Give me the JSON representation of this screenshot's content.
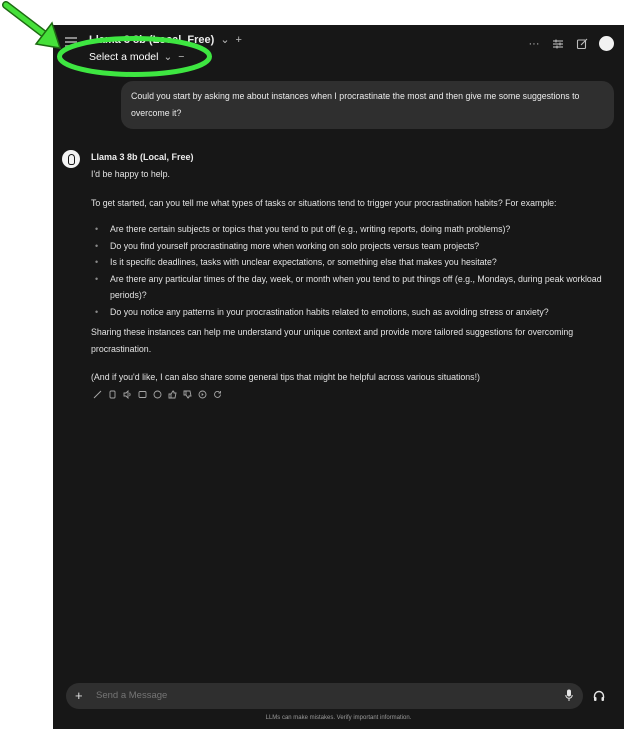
{
  "header": {
    "model_title": "Llama 3 8b (Local, Free)",
    "model_chevron": "⌄",
    "add_model": "+",
    "select_model": "Select a model",
    "select_chevron": "⌄",
    "remove_model": "−",
    "more_label": "···",
    "icons": [
      "menu-icon",
      "more-icon",
      "sliders-icon",
      "edit-icon",
      "avatar"
    ]
  },
  "user_message": "Could you start by asking me about instances when I procrastinate the most and then give me some suggestions to overcome it?",
  "assistant": {
    "name": "Llama 3 8b (Local, Free)",
    "intro": "I'd be happy to help.",
    "lead": "To get started, can you tell me what types of tasks or situations tend to trigger your procrastination habits? For example:",
    "bullets": [
      "Are there certain subjects or topics that you tend to put off (e.g., writing reports, doing math problems)?",
      "Do you find yourself procrastinating more when working on solo projects versus team projects?",
      "Is it specific deadlines, tasks with unclear expectations, or something else that makes you hesitate?",
      "Are there any particular times of the day, week, or month when you tend to put things off (e.g., Mondays, during peak workload periods)?",
      "Do you notice any patterns in your procrastination habits related to emotions, such as avoiding stress or anxiety?"
    ],
    "closing": "Sharing these instances can help me understand your unique context and provide more tailored suggestions for overcoming procrastination.",
    "postscript": "(And if you'd like, I can also share some general tips that might be helpful across various situations!)"
  },
  "message_actions": [
    "edit-icon",
    "copy-icon",
    "read-aloud-icon",
    "info-icon",
    "thumbs-up-icon",
    "thumbs-down-icon",
    "continue-icon",
    "regenerate-icon"
  ],
  "input": {
    "plus": "+",
    "placeholder": "Send a Message"
  },
  "disclaimer": "LLMs can make mistakes. Verify important information.",
  "colors": {
    "background": "#171717",
    "bubble": "#2f2f2f",
    "annotation_green": "#3ee641"
  }
}
